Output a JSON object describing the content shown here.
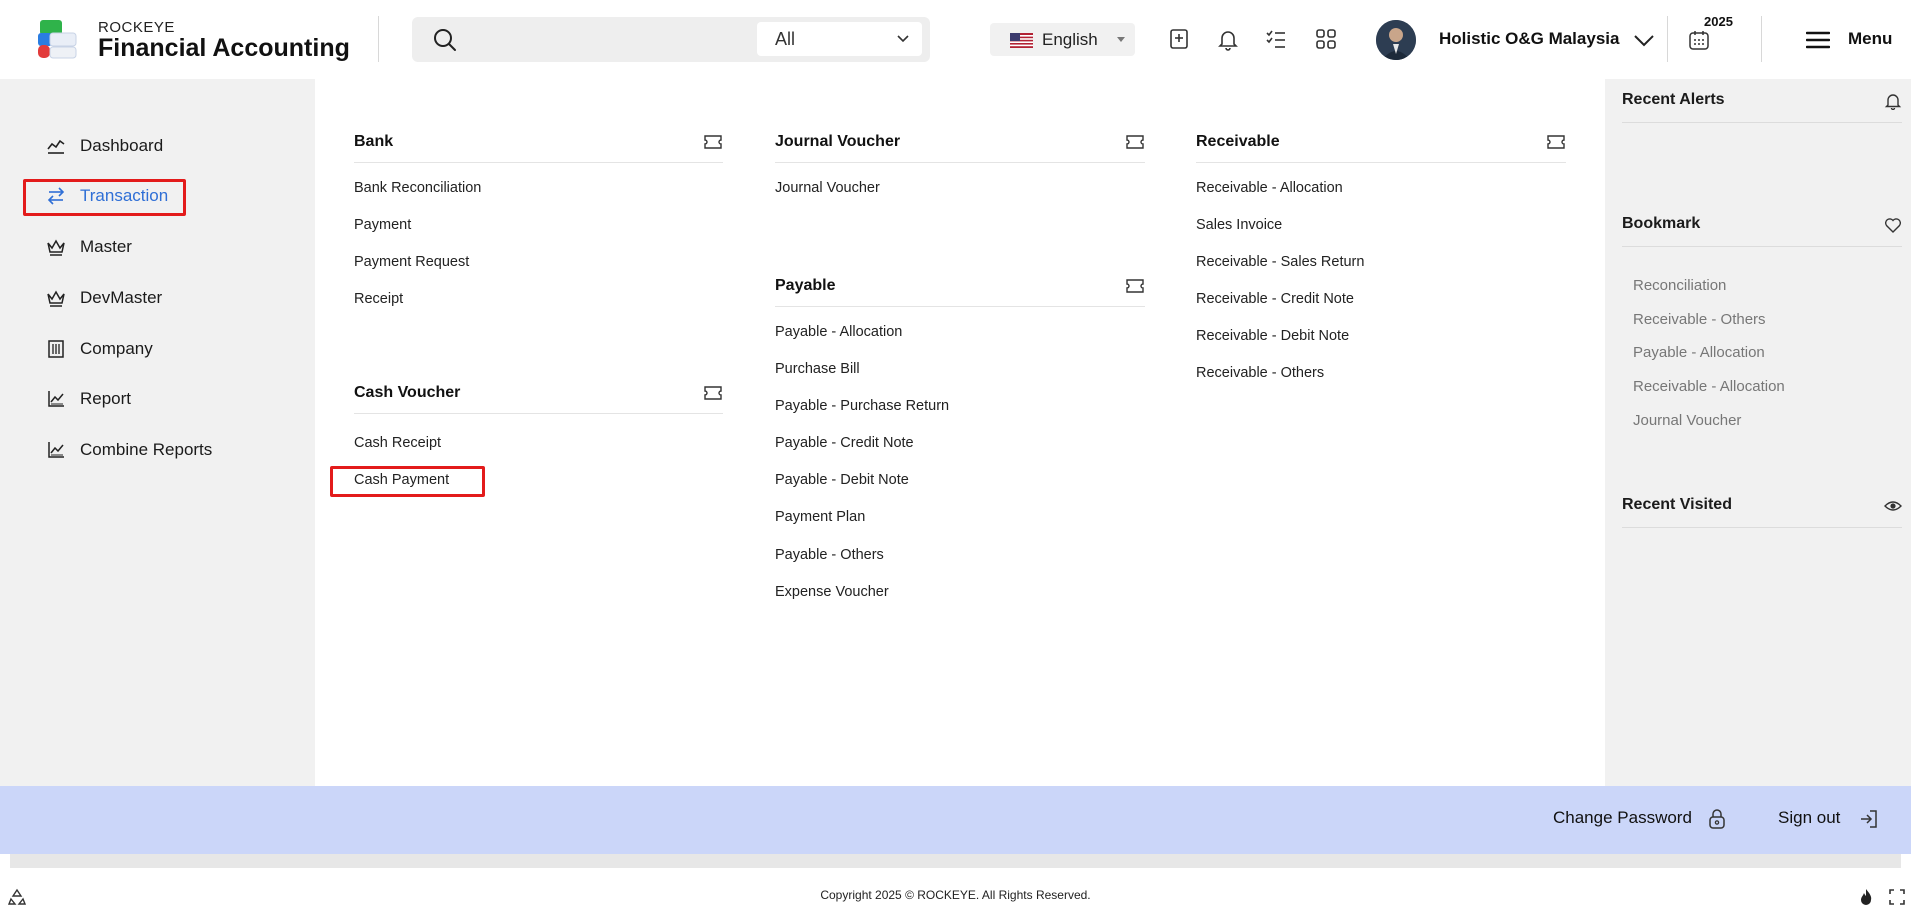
{
  "header": {
    "brand_small": "ROCKEYE",
    "brand_big": "Financial Accounting",
    "search_scope": "All",
    "language": "English",
    "company": "Holistic O&G Malaysia",
    "year": "2025",
    "menu_label": "Menu"
  },
  "sidebar": {
    "items": [
      {
        "label": "Dashboard",
        "icon": "chart-line-icon"
      },
      {
        "label": "Transaction",
        "icon": "swap-arrows-icon"
      },
      {
        "label": "Master",
        "icon": "crown-icon"
      },
      {
        "label": "DevMaster",
        "icon": "crown-icon"
      },
      {
        "label": "Company",
        "icon": "building-icon"
      },
      {
        "label": "Report",
        "icon": "report-chart-icon"
      },
      {
        "label": "Combine Reports",
        "icon": "report-chart-icon"
      }
    ],
    "active_index": 1
  },
  "menu": {
    "bank": {
      "title": "Bank",
      "links": [
        "Bank Reconciliation",
        "Payment",
        "Payment Request",
        "Receipt"
      ]
    },
    "cash_voucher": {
      "title": "Cash Voucher",
      "links": [
        "Cash Receipt",
        "Cash Payment"
      ]
    },
    "journal_voucher": {
      "title": "Journal Voucher",
      "links": [
        "Journal Voucher"
      ]
    },
    "payable": {
      "title": "Payable",
      "links": [
        "Payable - Allocation",
        "Purchase Bill",
        "Payable - Purchase Return",
        "Payable - Credit Note",
        "Payable - Debit Note",
        "Payment Plan",
        "Payable - Others",
        "Expense Voucher"
      ]
    },
    "receivable": {
      "title": "Receivable",
      "links": [
        "Receivable - Allocation",
        "Sales Invoice",
        "Receivable - Sales Return",
        "Receivable - Credit Note",
        "Receivable - Debit Note",
        "Receivable - Others"
      ]
    }
  },
  "right_panel": {
    "recent_alerts": "Recent Alerts",
    "bookmark": "Bookmark",
    "bookmarks": [
      "Reconciliation",
      "Receivable - Others",
      "Payable - Allocation",
      "Receivable - Allocation",
      "Journal Voucher"
    ],
    "recent_visited": "Recent Visited"
  },
  "footer": {
    "change_password": "Change Password",
    "sign_out": "Sign out",
    "copyright": "Copyright 2025 © ROCKEYE. All Rights Reserved."
  },
  "colors": {
    "accent": "#2f6fd6",
    "highlight": "#e31b1b",
    "footer_bar": "#cbd6f9",
    "panel_bg": "#f1f1f1"
  }
}
